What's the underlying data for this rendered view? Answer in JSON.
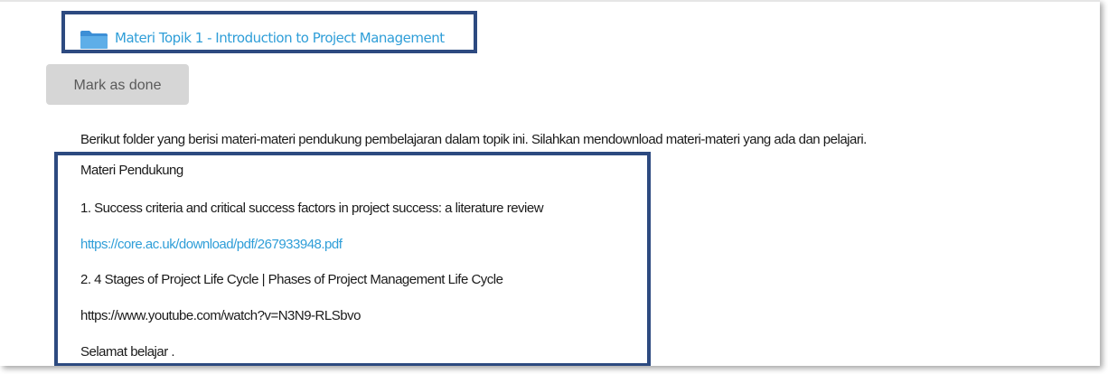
{
  "activity": {
    "title": "Materi Topik 1 - Introduction to Project Management",
    "icon": "folder-icon"
  },
  "buttons": {
    "mark_as_done": "Mark as done"
  },
  "description": {
    "intro": "Berikut folder yang berisi materi-materi pendukung pembelajaran dalam topik ini. Silahkan mendownload materi-materi yang ada dan pelajari.",
    "heading": "Materi Pendukung",
    "item1_title": "1. Success criteria and critical success factors in project success: a literature review",
    "item1_link": "https://core.ac.uk/download/pdf/267933948.pdf",
    "item2_title": "2. 4 Stages of Project Life Cycle | Phases of Project Management Life Cycle",
    "item2_link": "https://www.youtube.com/watch?v=N3N9-RLSbvo",
    "closing": "Selamat belajar ."
  },
  "colors": {
    "highlight_border": "#2d4a80",
    "link": "#2f9ed8",
    "button_bg": "#d6d6d6"
  }
}
